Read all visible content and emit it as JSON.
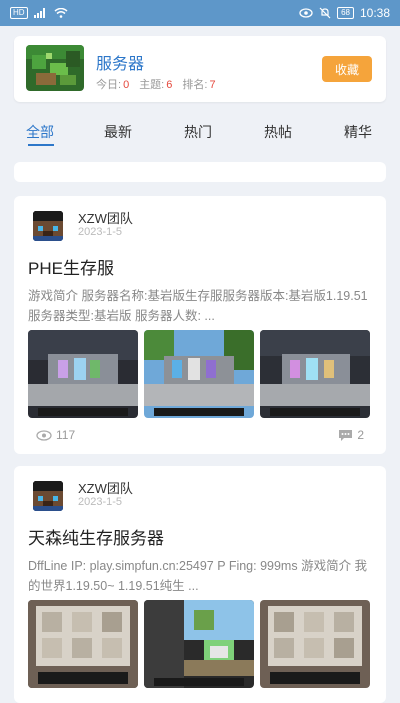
{
  "status_bar": {
    "left_chip": "HD",
    "signal": "4G",
    "battery": "68",
    "time": "10:38"
  },
  "forum": {
    "name": "服务器",
    "today_label": "今日:",
    "today_value": "0",
    "topics_label": "主题:",
    "topics_value": "6",
    "rank_label": "排名:",
    "rank_value": "7",
    "favorite_label": "收藏"
  },
  "tabs": [
    {
      "label": "全部",
      "active": true
    },
    {
      "label": "最新",
      "active": false
    },
    {
      "label": "热门",
      "active": false
    },
    {
      "label": "热帖",
      "active": false
    },
    {
      "label": "精华",
      "active": false
    }
  ],
  "posts": [
    {
      "author": "XZW团队",
      "date": "2023-1-5",
      "title": "PHE生存服",
      "excerpt": "游戏简介 服务器名称:基岩版生存服服务器版本:基岩版1.19.51 服务器类型:基岩版 服务器人数: ...",
      "views": "117",
      "comments": "2"
    },
    {
      "author": "XZW团队",
      "date": "2023-1-5",
      "title": "天森纯生存服务器",
      "excerpt": "DffLine IP: play.simpfun.cn:25497 P Fing: 999ms 游戏简介 我的世界1.19.50~ 1.19.51纯生 ..."
    }
  ],
  "colors": {
    "accent": "#2d77c9",
    "status_bar": "#5e97c9",
    "favorite": "#f5a43b",
    "stat_number": "#e5493d"
  }
}
